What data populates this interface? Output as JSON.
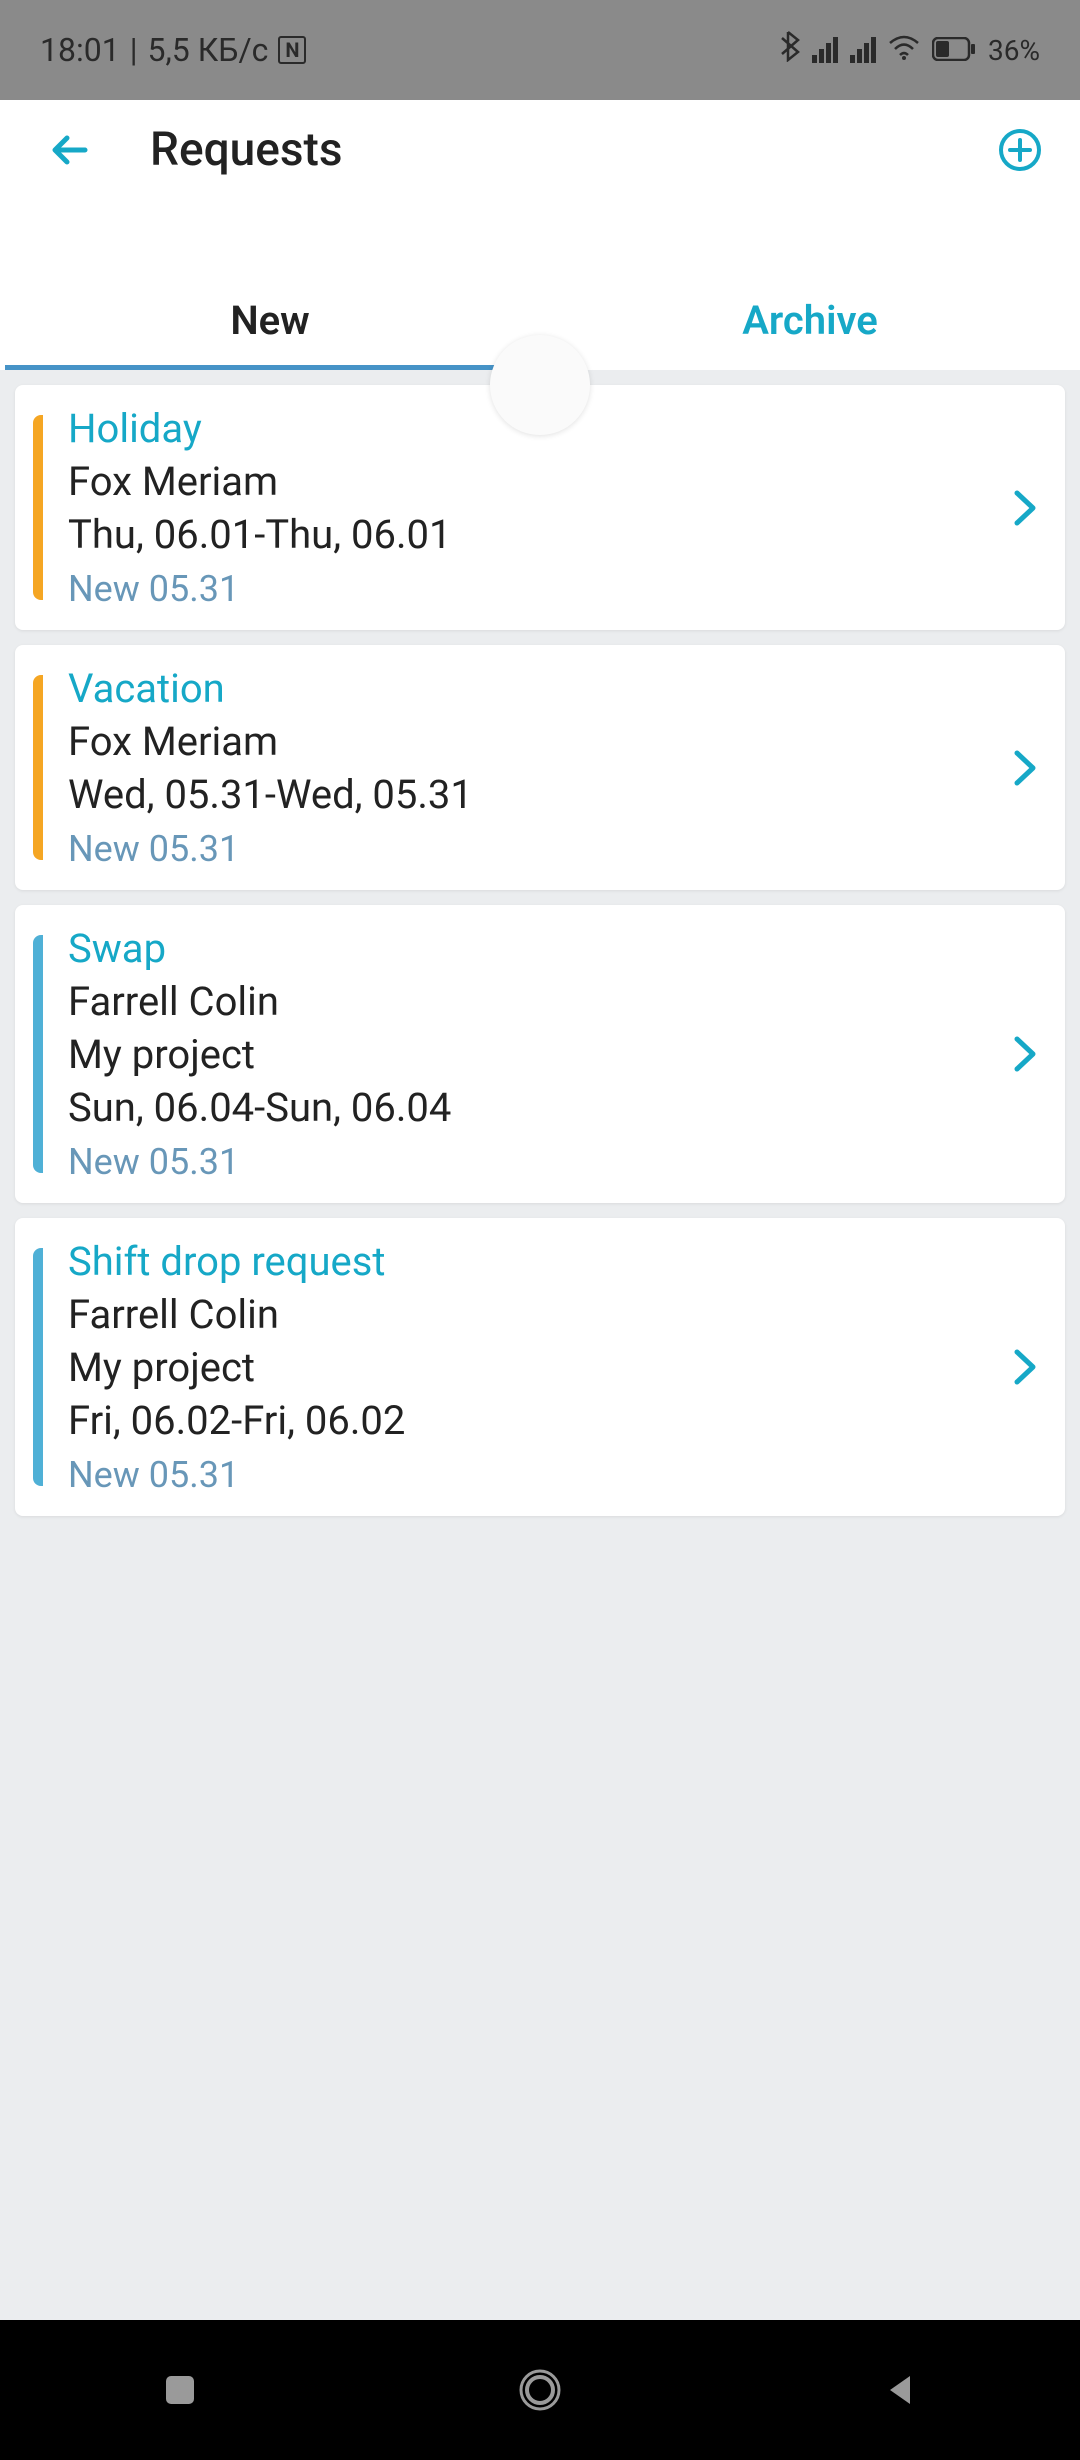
{
  "statusBar": {
    "time": "18:01",
    "dataSpeed": "5,5 КБ/c",
    "battery": "36%"
  },
  "header": {
    "title": "Requests"
  },
  "tabs": {
    "new": "New",
    "archive": "Archive"
  },
  "requests": [
    {
      "type": "Holiday",
      "person": "Fox Meriam",
      "project": "",
      "dates": "Thu, 06.01-Thu, 06.01",
      "status": "New 05.31",
      "accent": "orange"
    },
    {
      "type": "Vacation",
      "person": "Fox Meriam",
      "project": "",
      "dates": "Wed, 05.31-Wed, 05.31",
      "status": "New 05.31",
      "accent": "orange"
    },
    {
      "type": "Swap",
      "person": "Farrell Colin",
      "project": "My project",
      "dates": "Sun, 06.04-Sun, 06.04",
      "status": "New 05.31",
      "accent": "blue"
    },
    {
      "type": "Shift drop request",
      "person": "Farrell Colin",
      "project": "My project",
      "dates": "Fri, 06.02-Fri, 06.02",
      "status": "New 05.31",
      "accent": "blue"
    }
  ]
}
